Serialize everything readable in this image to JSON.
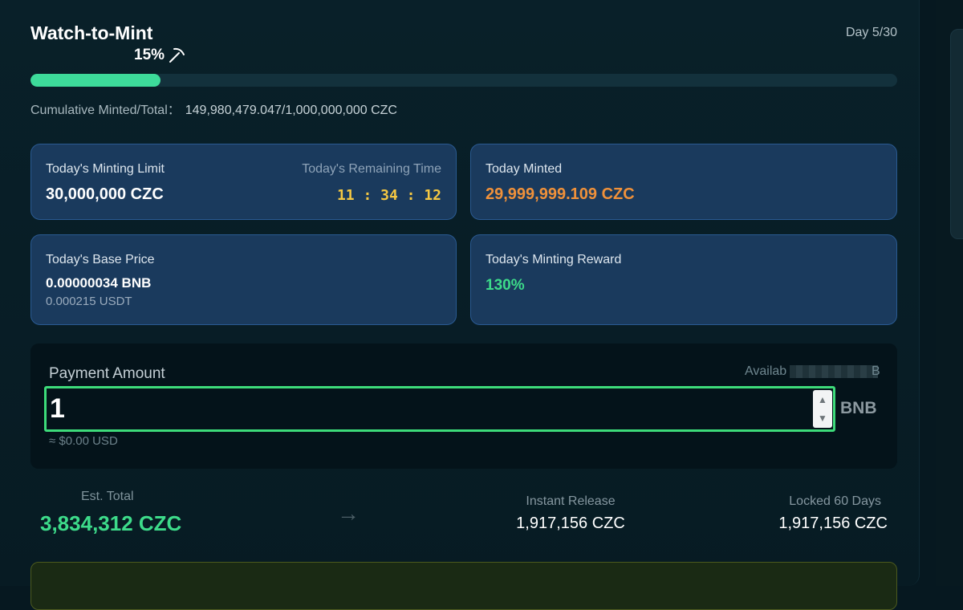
{
  "header": {
    "title": "Watch-to-Mint",
    "day": "Day 5/30",
    "progress_label": "15%",
    "progress_fraction": 0.15,
    "pickaxe_icon": "pickaxe-icon"
  },
  "cumulative": {
    "label": "Cumulative Minted/Total：",
    "value": "149,980,479.047/1,000,000,000 CZC"
  },
  "cards": {
    "minting_limit": {
      "label": "Today's Minting Limit",
      "value": "30,000,000 CZC",
      "time_label": "Today's Remaining Time",
      "time_value": "11 : 34 : 12"
    },
    "today_minted": {
      "label": "Today Minted",
      "value": "29,999,999.109 CZC"
    },
    "base_price": {
      "label": "Today's Base Price",
      "value_bnb": "0.00000034 BNB",
      "value_usdt": "0.000215 USDT"
    },
    "minting_reward": {
      "label": "Today's Minting Reward",
      "value": "130%"
    }
  },
  "payment": {
    "label": "Payment Amount",
    "available_prefix": "Availab",
    "available_suffix": "B",
    "amount_value": "1",
    "unit": "BNB",
    "usd_estimate": "≈ $0.00 USD"
  },
  "summary": {
    "est_label": "Est. Total",
    "est_value": "3,834,312 CZC",
    "arrow": "→",
    "instant_label": "Instant Release",
    "instant_value": "1,917,156 CZC",
    "locked_label": "Locked 60 Days",
    "locked_value": "1,917,156 CZC"
  },
  "colors": {
    "accent_green": "#3ddb9a",
    "time_yellow": "#f5c842",
    "minted_orange": "#f0913a",
    "reward_green": "#3ddb8a",
    "card_bg": "#1a3a5d"
  }
}
